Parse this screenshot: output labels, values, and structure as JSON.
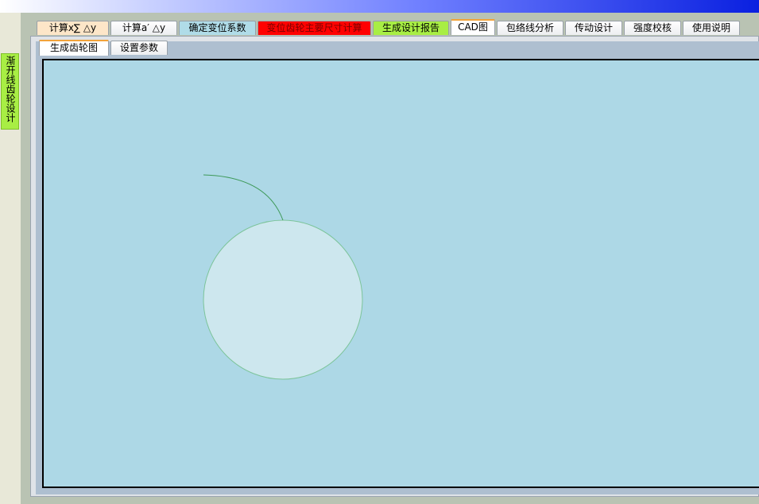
{
  "side_tab": {
    "label": "渐开线齿轮设计"
  },
  "main_tabs": [
    {
      "label": "计算x∑ △y"
    },
    {
      "label": "计算a′ △y"
    },
    {
      "label": "确定变位系数"
    },
    {
      "label": "变位齿轮主要尺寸计算"
    },
    {
      "label": "生成设计报告"
    },
    {
      "label": "CAD图"
    },
    {
      "label": "包络线分析"
    },
    {
      "label": "传动设计"
    },
    {
      "label": "强度校核"
    },
    {
      "label": "使用说明"
    }
  ],
  "sub_tabs": [
    {
      "label": "生成齿轮图"
    },
    {
      "label": "设置参数"
    }
  ],
  "active_main_tab": "CAD图",
  "active_sub_tab": "生成齿轮图",
  "colors": {
    "canvas_bg": "#add8e6",
    "gear_fill": "#cde7ee",
    "curve_stroke": "#3f9a5a",
    "circle_stroke": "#7cc49a"
  }
}
